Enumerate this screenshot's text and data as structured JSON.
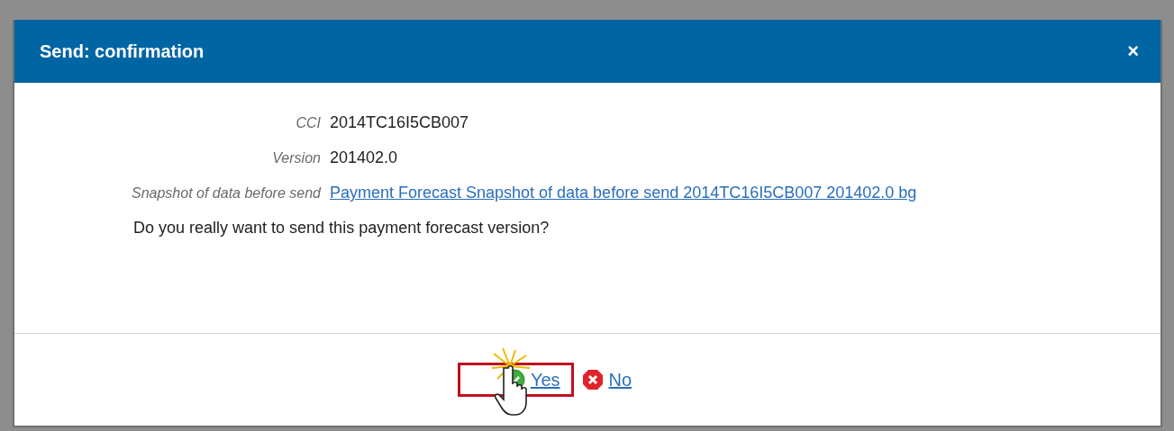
{
  "dialog": {
    "title": "Send: confirmation",
    "close": "×"
  },
  "fields": [
    {
      "label": "CCI",
      "value": "2014TC16I5CB007",
      "kind": "text"
    },
    {
      "label": "Version",
      "value": "201402.0",
      "kind": "text"
    },
    {
      "label": "Snapshot of data before send",
      "value": "Payment Forecast Snapshot of data before send 2014TC16I5CB007 201402.0 bg",
      "kind": "link"
    }
  ],
  "question": "Do you really want to send this payment forecast version?",
  "buttons": [
    {
      "label": "Yes",
      "kind": "confirm",
      "highlighted": true
    },
    {
      "label": "No",
      "kind": "cancel",
      "highlighted": false
    }
  ]
}
